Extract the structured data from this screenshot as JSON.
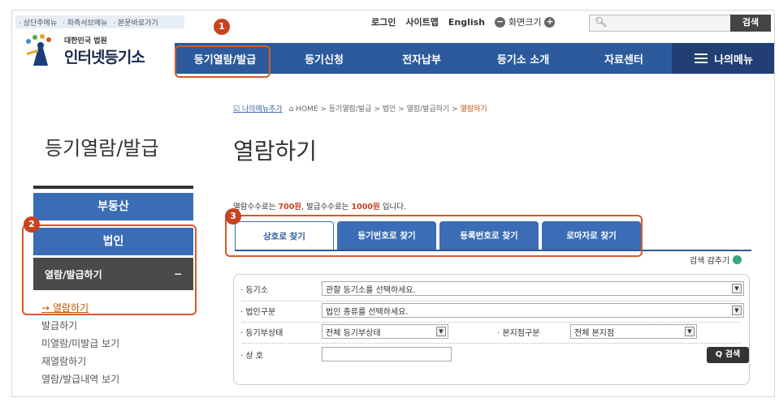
{
  "skip_links": [
    "· 상단주메뉴",
    "· 좌측서브메뉴",
    "· 본문바로가기"
  ],
  "util": {
    "login": "로그인",
    "sitemap": "사이트맵",
    "english": "English",
    "zoom_label": "화면크기",
    "zoom_minus": "−",
    "zoom_plus": "+"
  },
  "search": {
    "placeholder": "",
    "button": "검색"
  },
  "logo": {
    "sub": "대한민국 법원",
    "main": "인터넷등기소"
  },
  "gnb": [
    "등기열람/발급",
    "등기신청",
    "전자납부",
    "등기소 소개",
    "자료센터"
  ],
  "my_menu": "나의메뉴",
  "annotations": [
    "1",
    "2",
    "3"
  ],
  "lnb": {
    "title": "등기열람/발급",
    "btn_realestate": "부동산",
    "btn_corp": "법인",
    "sub_title": "열람/발급하기",
    "sub_toggle": "−",
    "items": [
      "→ 열람하기",
      "발급하기",
      "미열람/미발급 보기",
      "재열람하기",
      "열람/발급내역 보기"
    ]
  },
  "breadcrumb": {
    "favorite": "나의메뉴추가",
    "path": "HOME > 등기열람/발급 > 법인 > 열람/발급하기 >",
    "current": "열람하기"
  },
  "page_title": "열람하기",
  "fee": {
    "pre": "열람수수료는 ",
    "view": "700원",
    "mid": ", 발급수수료는 ",
    "issue": "1000원",
    "post": " 입니다."
  },
  "tabs": [
    "상호로 찾기",
    "등기번호로 찾기",
    "등록번호로 찾기",
    "로마자로 찾기"
  ],
  "collapse": "검색 감추기",
  "form": {
    "office_label": "· 등기소",
    "office_value": "관할 등기소를 선택하세요.",
    "type_label": "· 법인구분",
    "type_value": "법인 종류를 선택하세요.",
    "status_label": "· 등기부상태",
    "status_value": "전체 등기부상태",
    "branch_label": "· 본지점구분",
    "branch_value": "전체 본지점",
    "name_label": "· 상 호",
    "name_value": "",
    "search_button": "Q 검색"
  },
  "colors": {
    "gnb": "#2d5a9c",
    "accent": "#c9431f",
    "tab": "#3a6db5",
    "lnb_btn": "#3a6db5"
  }
}
